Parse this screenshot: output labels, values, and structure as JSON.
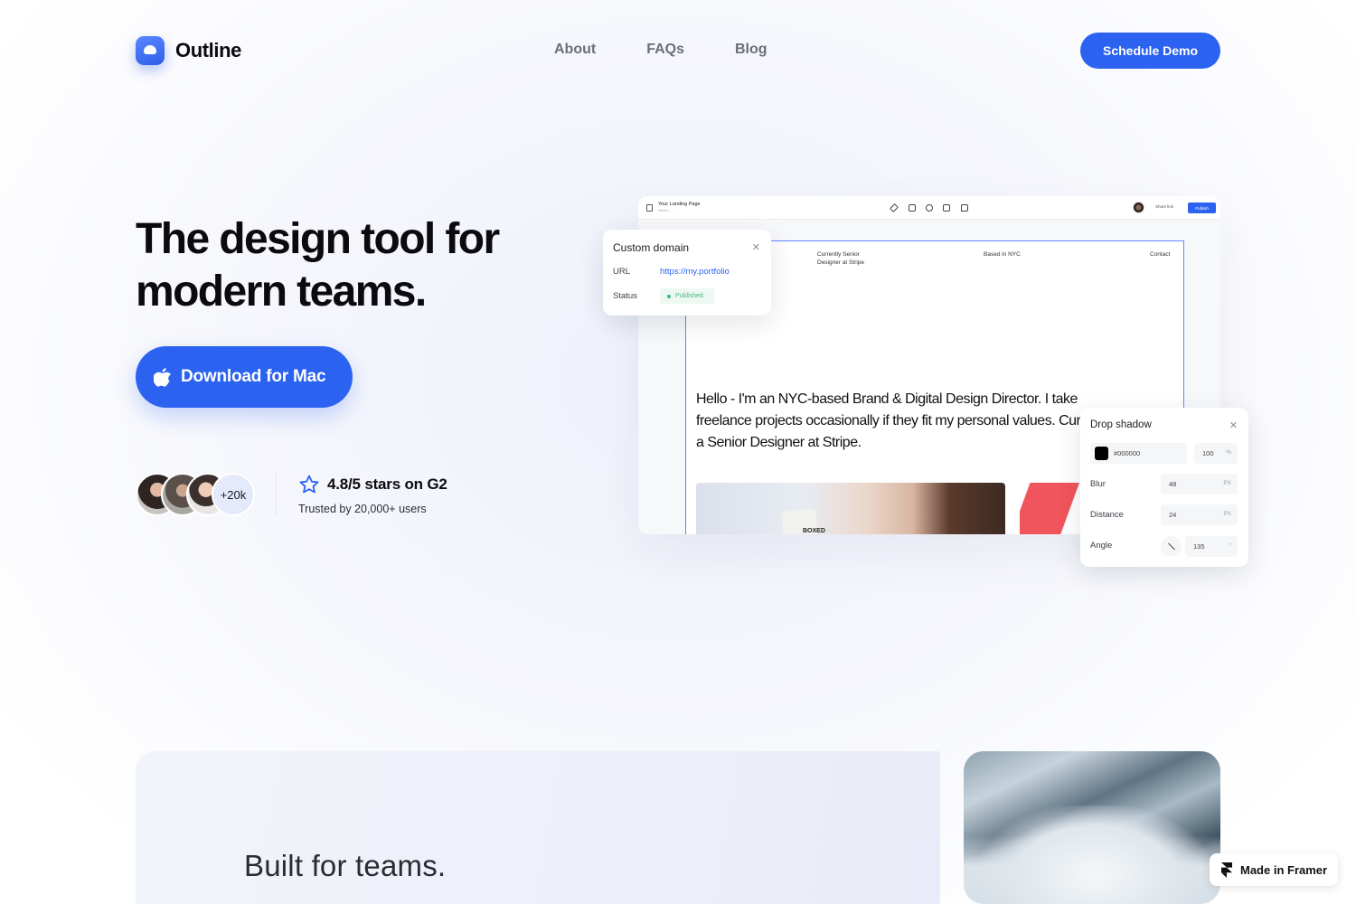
{
  "brand": {
    "name": "Outline",
    "logo_icon": "outline-logo-icon"
  },
  "nav": {
    "links": [
      "About",
      "FAQs",
      "Blog"
    ],
    "cta_label": "Schedule Demo"
  },
  "hero": {
    "title": "The design tool for modern teams.",
    "download_label": "Download for Mac",
    "download_icon": "apple-icon",
    "avatar_more": "+20k",
    "rating": "4.8/5 stars on G2",
    "rating_sub": "Trusted by 20,000+ users"
  },
  "app": {
    "page_name": "Your Landing Page",
    "page_sub": "Home / ...",
    "share_label": "Share link",
    "publish_label": "Publish",
    "canvas": {
      "col1": "Currently Senior Designer at Stripe",
      "col2": "Based in NYC",
      "col3": "Contact",
      "intro": "Hello - I'm an NYC-based Brand & Digital Design Director. I take freelance projects occasionally if they fit my personal values. Currently a Senior Designer at Stripe.",
      "photo_box_text": "BOXED"
    }
  },
  "custom_domain": {
    "title": "Custom domain",
    "url_label": "URL",
    "url_value": "https://my.portfolio",
    "status_label": "Status",
    "status_value": "Published"
  },
  "drop_shadow": {
    "title": "Drop shadow",
    "color_hex": "#000000",
    "opacity": "100",
    "opacity_unit": "%",
    "blur_label": "Blur",
    "blur_value": "48",
    "distance_label": "Distance",
    "distance_value": "24",
    "angle_label": "Angle",
    "angle_value": "135",
    "px_unit": "PX",
    "deg_unit": "°"
  },
  "feature": {
    "title": "Built for teams."
  },
  "framer_badge": {
    "label": "Made in Framer"
  },
  "colors": {
    "accent": "#2b62f0",
    "status_green": "#42b883"
  }
}
